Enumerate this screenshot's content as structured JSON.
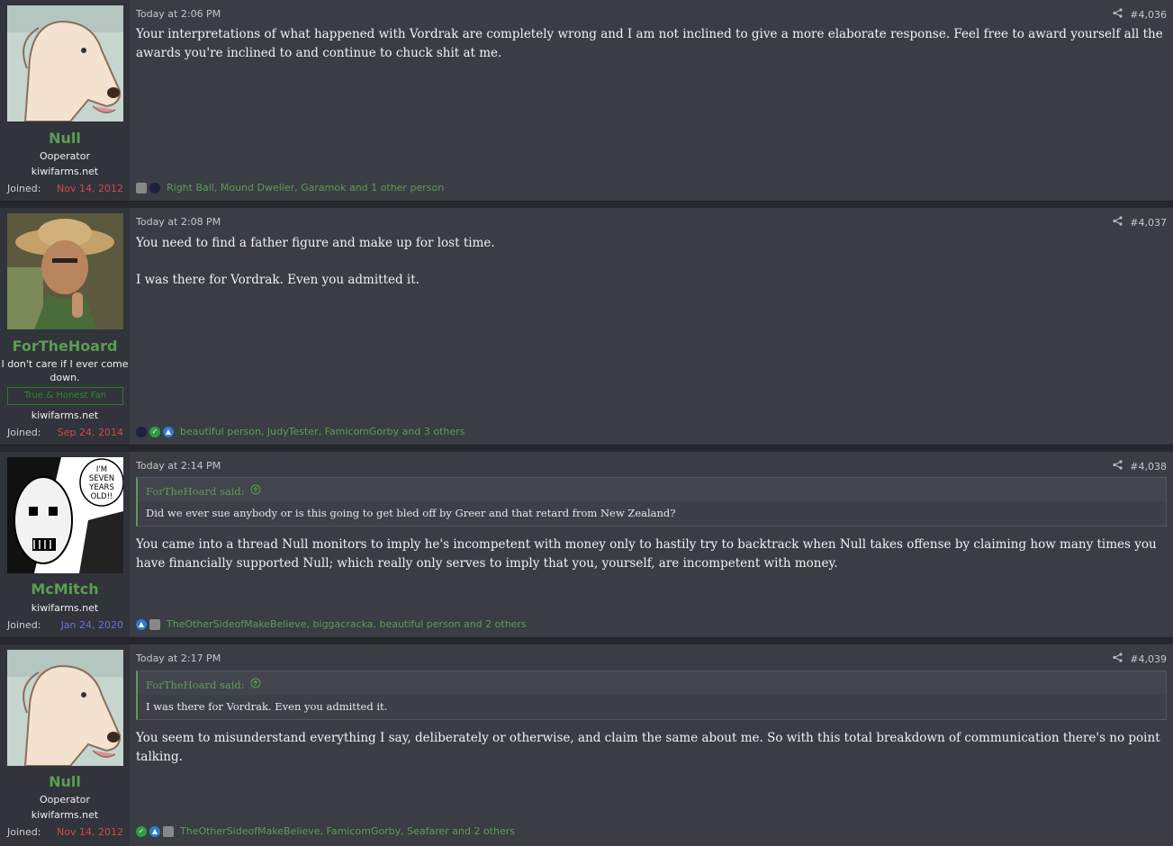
{
  "posts": [
    {
      "username": "Null",
      "user_title": "Ooperator",
      "site": "kiwifarms.net",
      "joined_label": "Joined:",
      "joined_date": "Nov 14, 2012",
      "joined_color": "#d24a4a",
      "time": "Today at 2:06 PM",
      "number": "#4,036",
      "paragraphs": [
        "Your interpretations of what happened with Vordrak are completely wrong and I am not inclined to give a more elaborate response. Feel free to award yourself all the awards you're inclined to and continue to chuck shit at me."
      ],
      "reactions": "Right Ball, Mound Dweller, Garamok and 1 other person"
    },
    {
      "username": "ForTheHoard",
      "user_title": "I don't care if I ever come down.",
      "banner": "True & Honest Fan",
      "site": "kiwifarms.net",
      "joined_label": "Joined:",
      "joined_date": "Sep 24, 2014",
      "joined_color": "#d24a4a",
      "time": "Today at 2:08 PM",
      "number": "#4,037",
      "paragraphs": [
        "You need to find a father figure and make up for lost time.",
        "I was there for Vordrak. Even you admitted it."
      ],
      "reactions": "beautiful person, JudyTester, FamicomGorby and 3 others"
    },
    {
      "username": "McMitch",
      "site": "kiwifarms.net",
      "joined_label": "Joined:",
      "joined_date": "Jan 24, 2020",
      "joined_color": "#6f6fe0",
      "time": "Today at 2:14 PM",
      "number": "#4,038",
      "quote_author": "ForTheHoard said:",
      "quote_text": "Did we ever sue anybody or is this going to get bled off by Greer and that retard from New Zealand?",
      "paragraphs": [
        "You came into a thread Null monitors to imply he's incompetent with money only to hastily try to backtrack when Null takes offense by claiming how many times you have financially supported Null; which really only serves to imply that you, yourself, are incompetent with money."
      ],
      "reactions": "TheOtherSideofMakeBelieve, biggacracka, beautiful person and 2 others"
    },
    {
      "username": "Null",
      "user_title": "Ooperator",
      "site": "kiwifarms.net",
      "joined_label": "Joined:",
      "joined_date": "Nov 14, 2012",
      "joined_color": "#d24a4a",
      "time": "Today at 2:17 PM",
      "number": "#4,039",
      "quote_author": "ForTheHoard said:",
      "quote_text": "I was there for Vordrak. Even you admitted it.",
      "paragraphs": [
        "You seem to misunderstand everything I say, deliberately or otherwise, and claim the same about me. So with this total breakdown of communication there's no point talking."
      ],
      "reactions": "TheOtherSideofMakeBelieve, FamicomGorby, Seafarer and 2 others"
    }
  ],
  "avatar_text": "I'M SEVEN YEARS OLD!!"
}
